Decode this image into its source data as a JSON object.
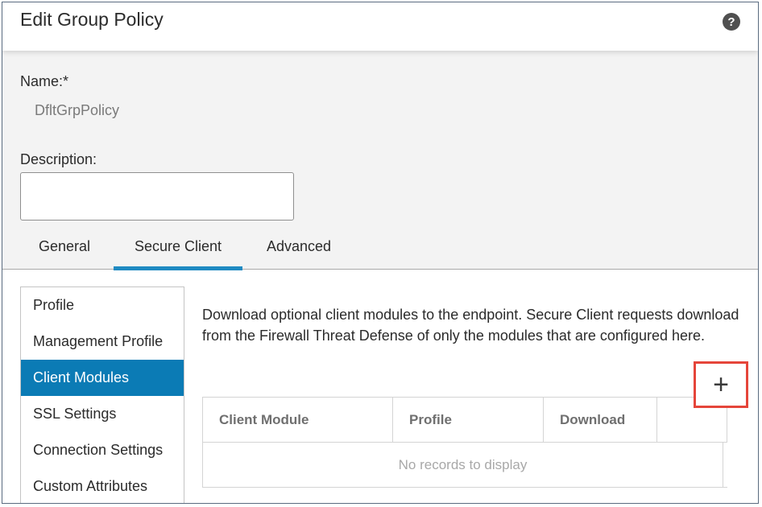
{
  "dialog": {
    "title": "Edit Group Policy",
    "help_icon": "?"
  },
  "form": {
    "name_label": "Name:*",
    "name_value": "DfltGrpPolicy",
    "description_label": "Description:",
    "description_value": ""
  },
  "tabs": [
    {
      "label": "General",
      "active": false
    },
    {
      "label": "Secure Client",
      "active": true
    },
    {
      "label": "Advanced",
      "active": false
    }
  ],
  "side_nav": {
    "items": [
      {
        "label": "Profile"
      },
      {
        "label": "Management Profile"
      },
      {
        "label": "Client Modules",
        "active": true
      },
      {
        "label": "SSL Settings"
      },
      {
        "label": "Connection Settings"
      },
      {
        "label": "Custom Attributes"
      }
    ]
  },
  "content": {
    "description": "Download optional client modules to the endpoint. Secure Client requests download from the Firewall Threat Defense of only the modules that are configured here.",
    "add_icon": "+"
  },
  "table": {
    "columns": [
      "Client Module",
      "Profile",
      "Download",
      ""
    ],
    "empty_message": "No records to display"
  },
  "colors": {
    "accent": "#0b7bb5",
    "tab_indicator": "#1e8ac2",
    "highlight_box": "#e5453a"
  }
}
